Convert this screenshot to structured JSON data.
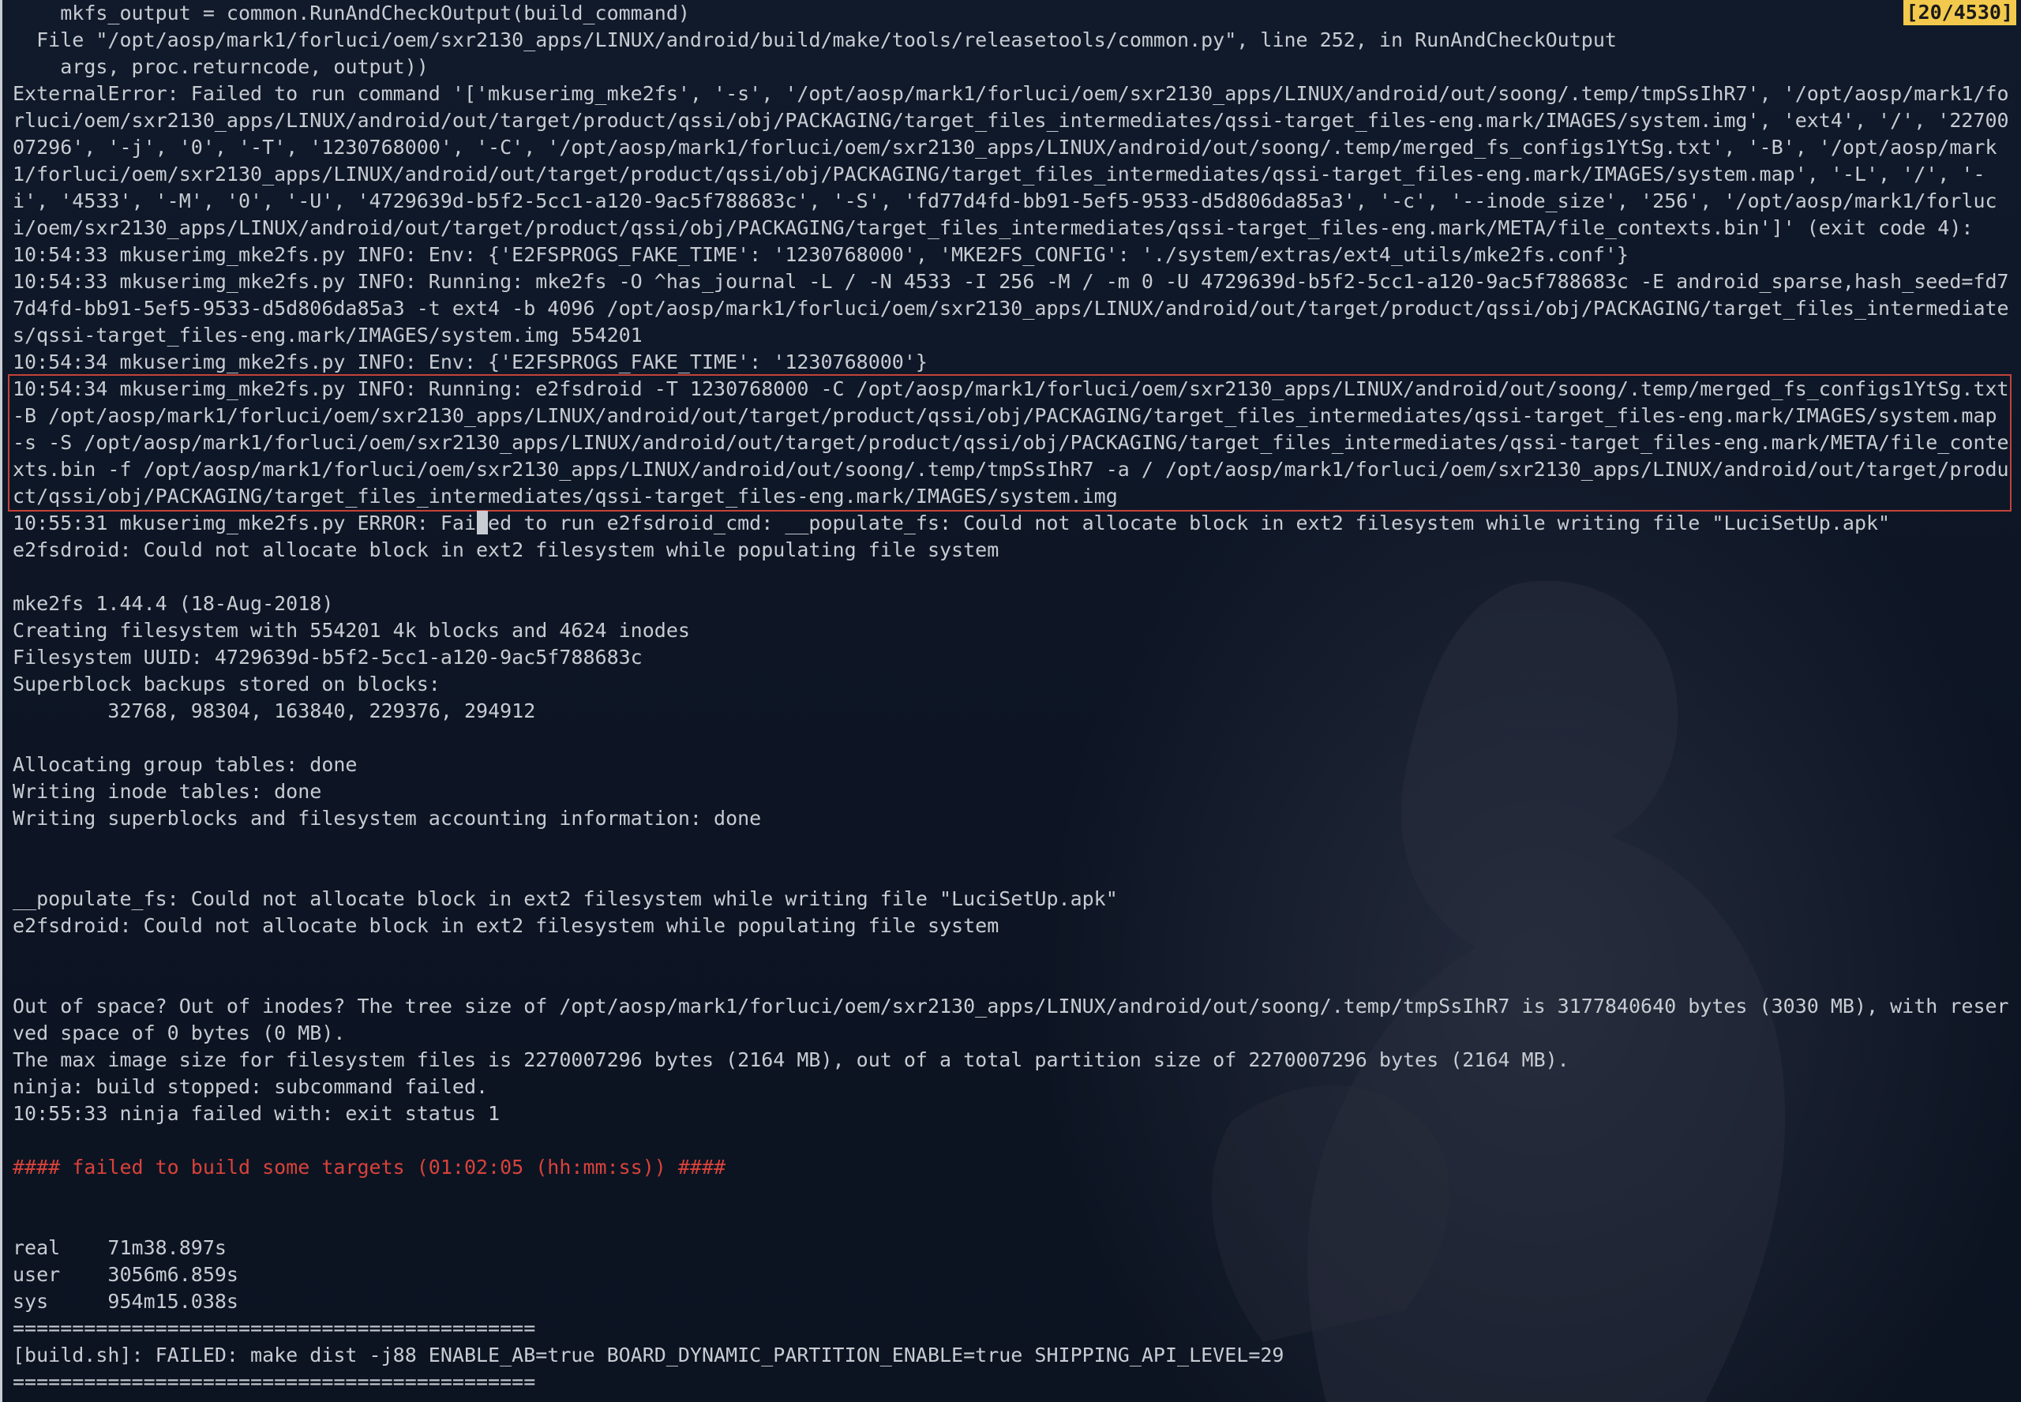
{
  "terminal": {
    "scroll_counter": "[20/4530]",
    "colors": {
      "background": "#0e1626",
      "text": "#c8ccd2",
      "error_text": "#d9423a",
      "highlight_border": "#c3433a",
      "counter_bg": "#f2c94c"
    },
    "lines": [
      "    mkfs_output = common.RunAndCheckOutput(build_command)",
      "  File \"/opt/aosp/mark1/forluci/oem/sxr2130_apps/LINUX/android/build/make/tools/releasetools/common.py\", line 252, in RunAndCheckOutput",
      "    args, proc.returncode, output))",
      "ExternalError: Failed to run command '['mkuserimg_mke2fs', '-s', '/opt/aosp/mark1/forluci/oem/sxr2130_apps/LINUX/android/out/soong/.temp/tmpSsIhR7', '/opt/aosp/mark1/forluci/oem/sxr2130_apps/LINUX/android/out/target/product/qssi/obj/PACKAGING/target_files_intermediates/qssi-target_files-eng.mark/IMAGES/system.img', 'ext4', '/', '2270007296', '-j', '0', '-T', '1230768000', '-C', '/opt/aosp/mark1/forluci/oem/sxr2130_apps/LINUX/android/out/soong/.temp/merged_fs_configs1YtSg.txt', '-B', '/opt/aosp/mark1/forluci/oem/sxr2130_apps/LINUX/android/out/target/product/qssi/obj/PACKAGING/target_files_intermediates/qssi-target_files-eng.mark/IMAGES/system.map', '-L', '/', '-i', '4533', '-M', '0', '-U', '4729639d-b5f2-5cc1-a120-9ac5f788683c', '-S', 'fd77d4fd-bb91-5ef5-9533-d5d806da85a3', '-c', '--inode_size', '256', '/opt/aosp/mark1/forluci/oem/sxr2130_apps/LINUX/android/out/target/product/qssi/obj/PACKAGING/target_files_intermediates/qssi-target_files-eng.mark/META/file_contexts.bin']' (exit code 4):",
      "10:54:33 mkuserimg_mke2fs.py INFO: Env: {'E2FSPROGS_FAKE_TIME': '1230768000', 'MKE2FS_CONFIG': './system/extras/ext4_utils/mke2fs.conf'}",
      "10:54:33 mkuserimg_mke2fs.py INFO: Running: mke2fs -O ^has_journal -L / -N 4533 -I 256 -M / -m 0 -U 4729639d-b5f2-5cc1-a120-9ac5f788683c -E android_sparse,hash_seed=fd77d4fd-bb91-5ef5-9533-d5d806da85a3 -t ext4 -b 4096 /opt/aosp/mark1/forluci/oem/sxr2130_apps/LINUX/android/out/target/product/qssi/obj/PACKAGING/target_files_intermediates/qssi-target_files-eng.mark/IMAGES/system.img 554201",
      "10:54:34 mkuserimg_mke2fs.py INFO: Env: {'E2FSPROGS_FAKE_TIME': '1230768000'}",
      "10:54:34 mkuserimg_mke2fs.py INFO: Running: e2fsdroid -T 1230768000 -C /opt/aosp/mark1/forluci/oem/sxr2130_apps/LINUX/android/out/soong/.temp/merged_fs_configs1YtSg.txt -B /opt/aosp/mark1/forluci/oem/sxr2130_apps/LINUX/android/out/target/product/qssi/obj/PACKAGING/target_files_intermediates/qssi-target_files-eng.mark/IMAGES/system.map -s -S /opt/aosp/mark1/forluci/oem/sxr2130_apps/LINUX/android/out/target/product/qssi/obj/PACKAGING/target_files_intermediates/qssi-target_files-eng.mark/META/file_contexts.bin -f /opt/aosp/mark1/forluci/oem/sxr2130_apps/LINUX/android/out/soong/.temp/tmpSsIhR7 -a / /opt/aosp/mark1/forluci/oem/sxr2130_apps/LINUX/android/out/target/product/qssi/obj/PACKAGING/target_files_intermediates/qssi-target_files-eng.mark/IMAGES/system.img",
      "10:55:31 mkuserimg_mke2fs.py ERROR: Failed to run e2fsdroid_cmd: __populate_fs: Could not allocate block in ext2 filesystem while writing file \"LuciSetUp.apk\"",
      "e2fsdroid: Could not allocate block in ext2 filesystem while populating file system",
      "",
      "mke2fs 1.44.4 (18-Aug-2018)",
      "Creating filesystem with 554201 4k blocks and 4624 inodes",
      "Filesystem UUID: 4729639d-b5f2-5cc1-a120-9ac5f788683c",
      "Superblock backups stored on blocks:",
      "        32768, 98304, 163840, 229376, 294912",
      "",
      "Allocating group tables: done",
      "Writing inode tables: done",
      "Writing superblocks and filesystem accounting information: done",
      "",
      "",
      "__populate_fs: Could not allocate block in ext2 filesystem while writing file \"LuciSetUp.apk\"",
      "e2fsdroid: Could not allocate block in ext2 filesystem while populating file system",
      "",
      "",
      "Out of space? Out of inodes? The tree size of /opt/aosp/mark1/forluci/oem/sxr2130_apps/LINUX/android/out/soong/.temp/tmpSsIhR7 is 3177840640 bytes (3030 MB), with reserved space of 0 bytes (0 MB).",
      "The max image size for filesystem files is 2270007296 bytes (2164 MB), out of a total partition size of 2270007296 bytes (2164 MB).",
      "ninja: build stopped: subcommand failed.",
      "10:55:33 ninja failed with: exit status 1",
      "",
      "#### failed to build some targets (01:02:05 (hh:mm:ss)) ####",
      "",
      "",
      "real    71m38.897s",
      "user    3056m6.859s",
      "sys     954m15.038s",
      "============================================",
      "[build.sh]: FAILED: make dist -j88 ENABLE_AB=true BOARD_DYNAMIC_PARTITION_ENABLE=true SHIPPING_API_LEVEL=29",
      "============================================"
    ]
  }
}
